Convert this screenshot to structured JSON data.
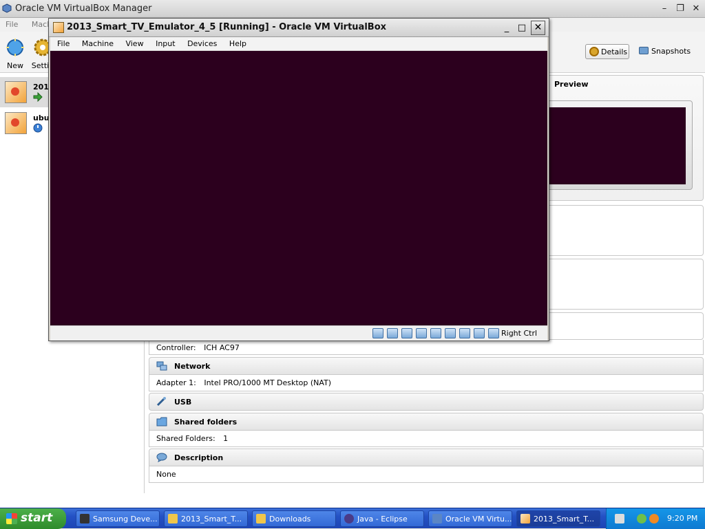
{
  "manager": {
    "title": "Oracle VM VirtualBox Manager",
    "menu": [
      "File",
      "Machine"
    ],
    "toolbar": {
      "new_label": "New",
      "settings_label": "Settin",
      "details_label": "Details",
      "snapshots_label": "Snapshots"
    },
    "vms": [
      {
        "name": "201",
        "state": "running"
      },
      {
        "name": "ubu",
        "state": "powered-off"
      }
    ],
    "preview_label": "Preview",
    "sections": {
      "audio": {
        "controller_label": "Controller:",
        "controller_value": "ICH AC97"
      },
      "network": {
        "title": "Network",
        "adapter_label": "Adapter 1:",
        "adapter_value": "Intel PRO/1000 MT Desktop (NAT)"
      },
      "usb": {
        "title": "USB"
      },
      "shared": {
        "title": "Shared folders",
        "label": "Shared Folders:",
        "value": "1"
      },
      "description": {
        "title": "Description",
        "value": "None"
      }
    }
  },
  "vm_window": {
    "title": "2013_Smart_TV_Emulator_4_5 [Running] - Oracle VM VirtualBox",
    "menu": [
      "File",
      "Machine",
      "View",
      "Input",
      "Devices",
      "Help"
    ],
    "host_key": "Right Ctrl",
    "screen_color": "#2c001e"
  },
  "taskbar": {
    "start_label": "start",
    "tasks": [
      {
        "label": "Samsung Deve...",
        "icon": "samsung-icon"
      },
      {
        "label": "2013_Smart_T...",
        "icon": "folder-icon"
      },
      {
        "label": "Downloads",
        "icon": "folder-icon"
      },
      {
        "label": "Java - Eclipse",
        "icon": "eclipse-icon"
      },
      {
        "label": "Oracle VM Virtu...",
        "icon": "virtualbox-icon"
      },
      {
        "label": "2013_Smart_T...",
        "icon": "vm-icon"
      }
    ],
    "clock": "9:20 PM"
  }
}
